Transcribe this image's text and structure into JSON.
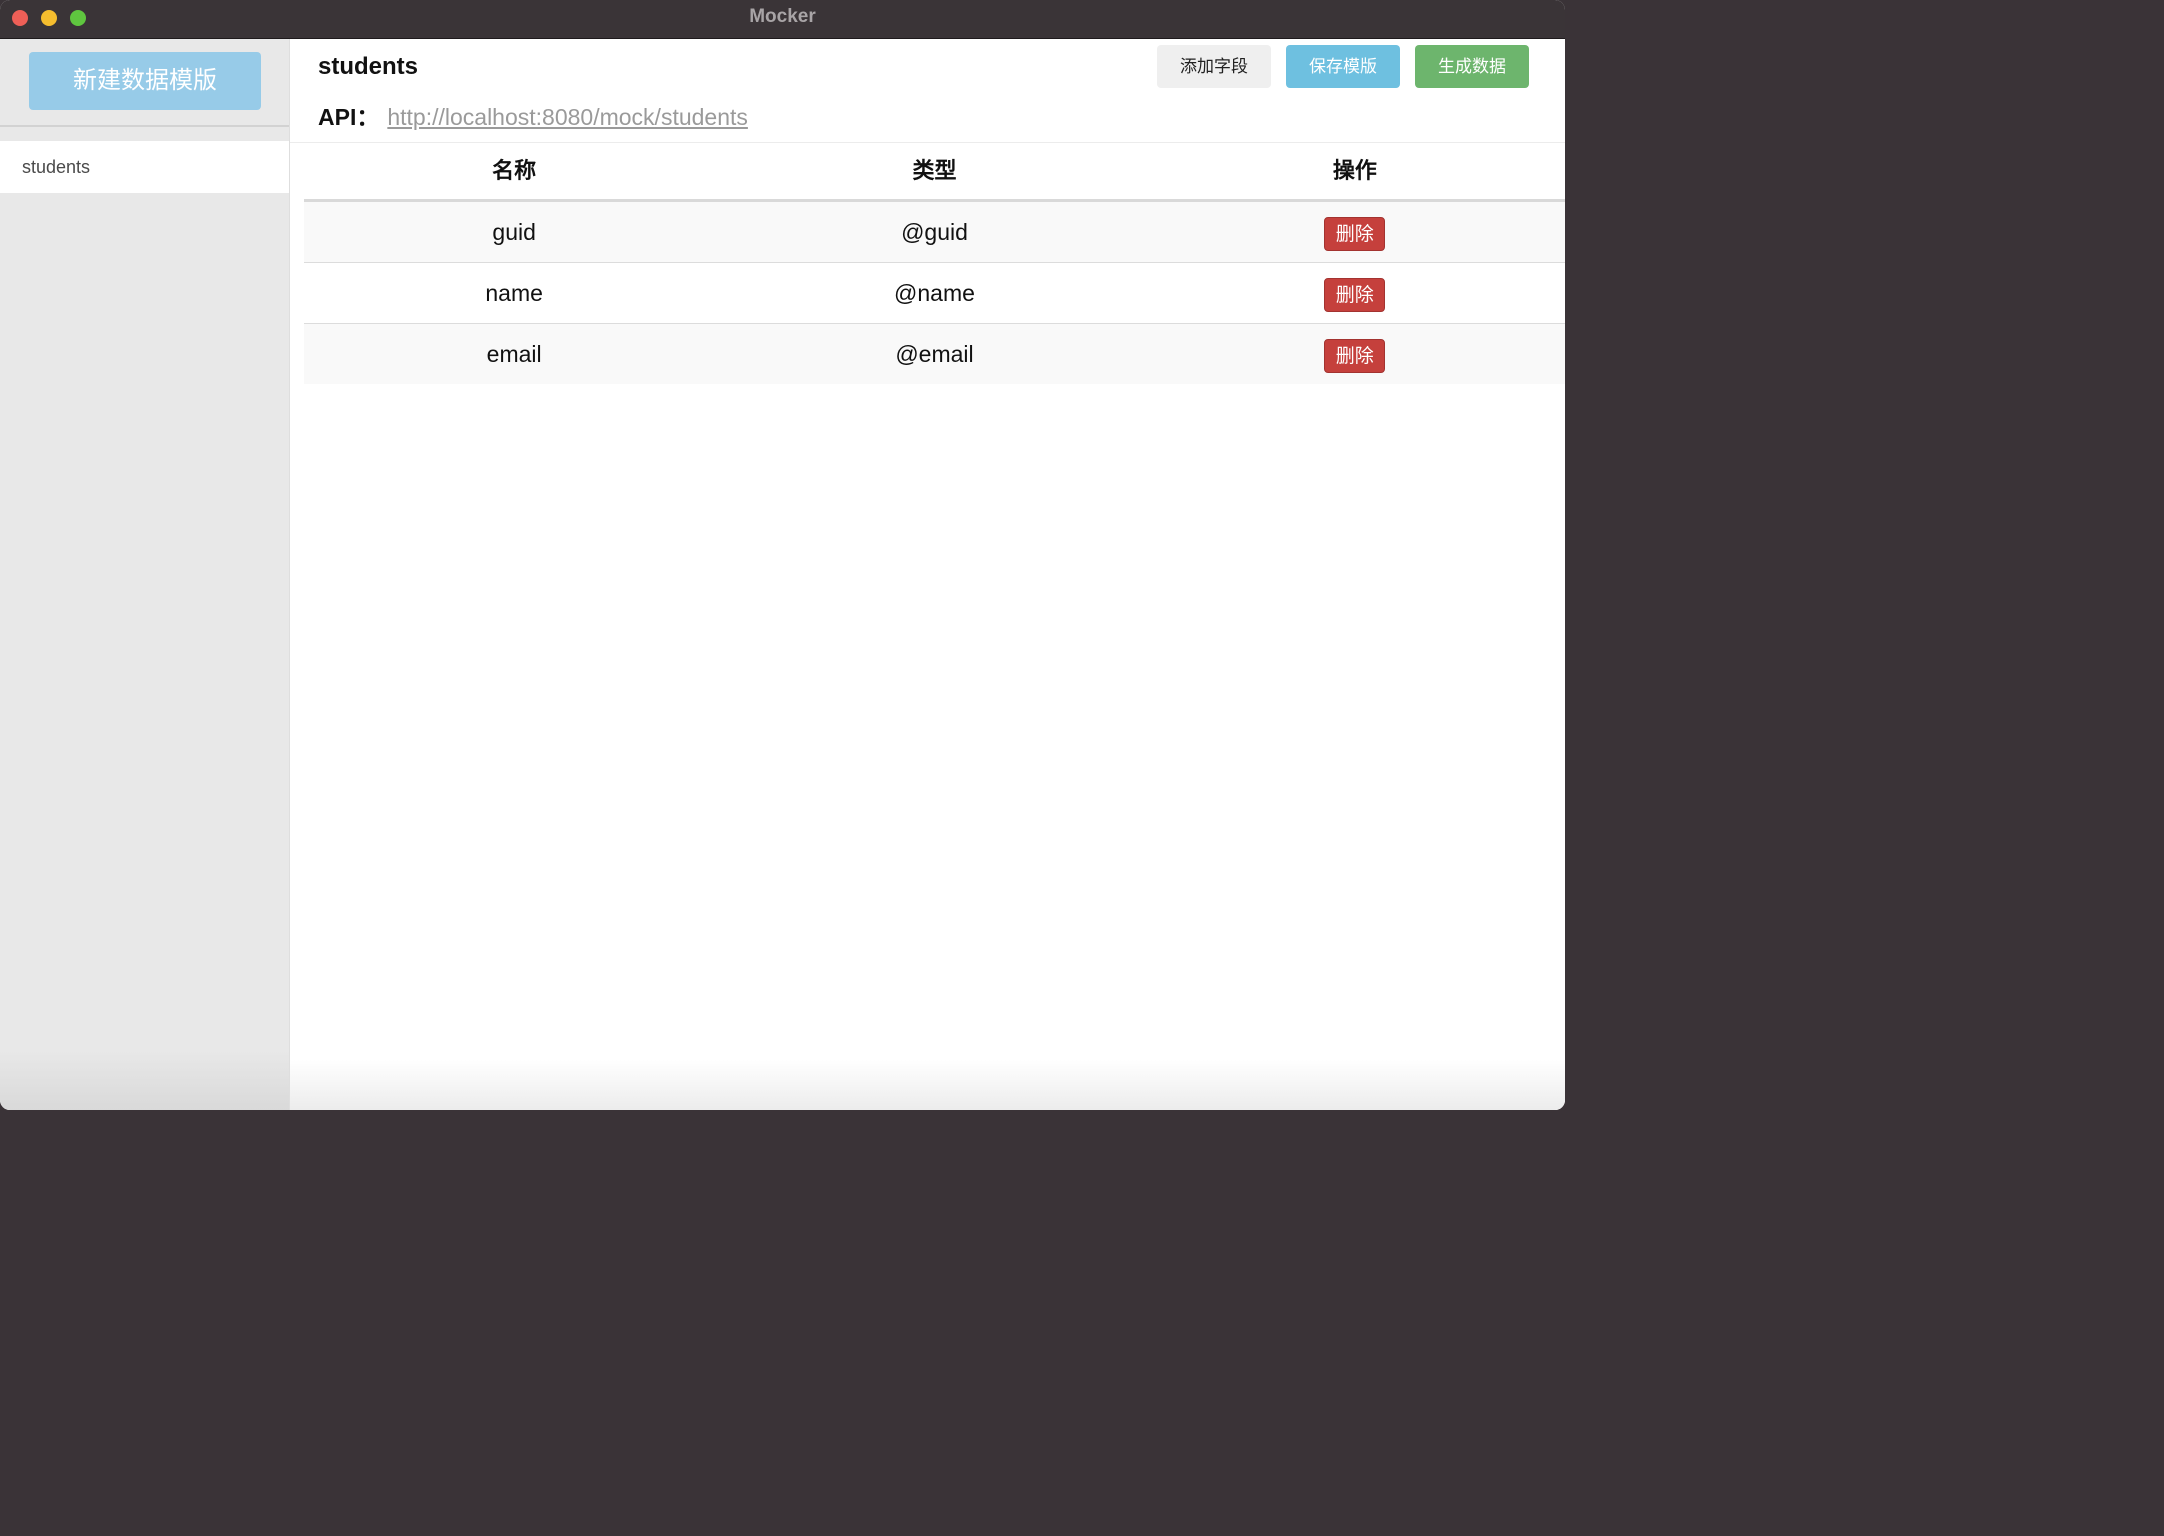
{
  "window": {
    "title": "Mocker"
  },
  "sidebar": {
    "new_template_label": "新建数据模版",
    "items": [
      {
        "label": "students"
      }
    ]
  },
  "header": {
    "template_name": "students",
    "api_label": "API：",
    "api_url": "http://localhost:8080/mock/students"
  },
  "toolbar": {
    "add_field_label": "添加字段",
    "save_template_label": "保存模版",
    "generate_data_label": "生成数据"
  },
  "table": {
    "headers": [
      "名称",
      "类型",
      "操作"
    ],
    "rows": [
      {
        "name": "guid",
        "type": "@guid",
        "action_label": "删除"
      },
      {
        "name": "name",
        "type": "@name",
        "action_label": "删除"
      },
      {
        "name": "email",
        "type": "@email",
        "action_label": "删除"
      }
    ]
  },
  "colors": {
    "new_template_button": "#97cbe8",
    "save_button": "#6ec0e0",
    "generate_button": "#6db56d",
    "delete_button": "#c5403c"
  }
}
